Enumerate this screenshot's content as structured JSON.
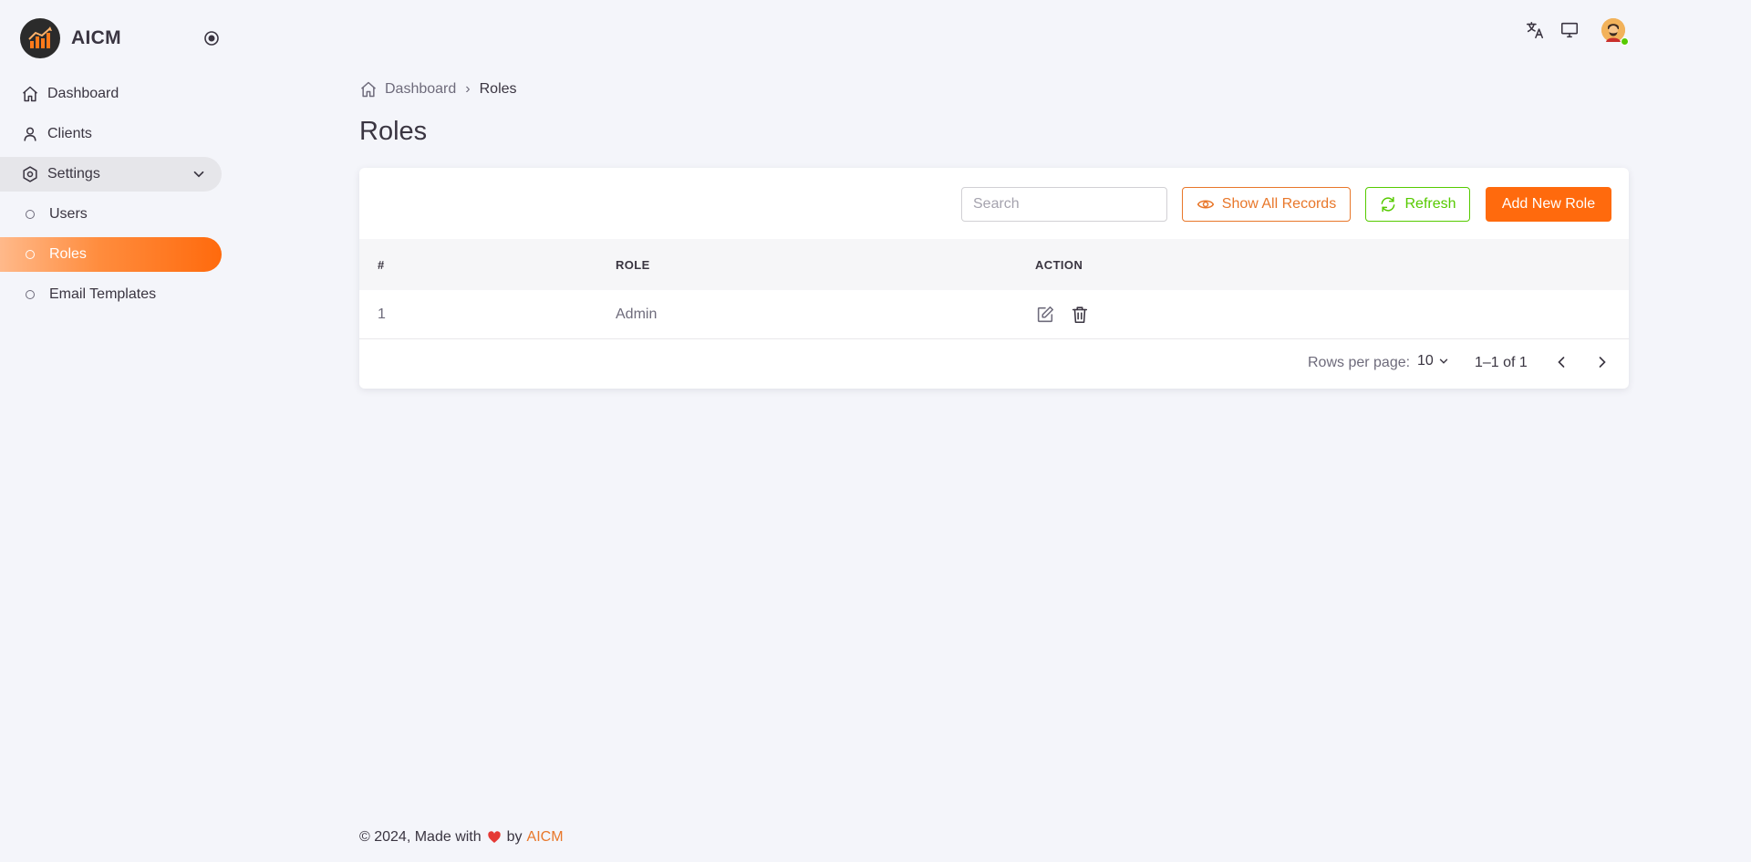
{
  "brand": {
    "name": "AICM"
  },
  "sidebar": {
    "items": [
      {
        "label": "Dashboard",
        "icon": "home-icon"
      },
      {
        "label": "Clients",
        "icon": "user-icon"
      },
      {
        "label": "Settings",
        "icon": "gear-icon",
        "expanded": true
      }
    ],
    "sub_items": [
      {
        "label": "Users"
      },
      {
        "label": "Roles",
        "active": true
      },
      {
        "label": "Email Templates"
      }
    ]
  },
  "topbar": {
    "icons": [
      "translate-icon",
      "monitor-icon"
    ]
  },
  "breadcrumb": {
    "home": "Dashboard",
    "separator": "›",
    "current": "Roles"
  },
  "page": {
    "title": "Roles"
  },
  "toolbar": {
    "search_placeholder": "Search",
    "show_all_label": "Show All Records",
    "refresh_label": "Refresh",
    "add_label": "Add New Role"
  },
  "table": {
    "headers": [
      "#",
      "ROLE",
      "ACTION"
    ],
    "rows": [
      {
        "num": "1",
        "role": "Admin"
      }
    ]
  },
  "pagination": {
    "rows_per_page_label": "Rows per page:",
    "rows_per_page_value": "10",
    "range": "1–1 of 1"
  },
  "footer": {
    "prefix": "© 2024, Made with",
    "by": "by",
    "brand": "AICM"
  },
  "colors": {
    "accent": "#ff6a0d",
    "accent_outline": "#e8772a",
    "success": "#56ca00",
    "background": "#f4f5fa"
  }
}
